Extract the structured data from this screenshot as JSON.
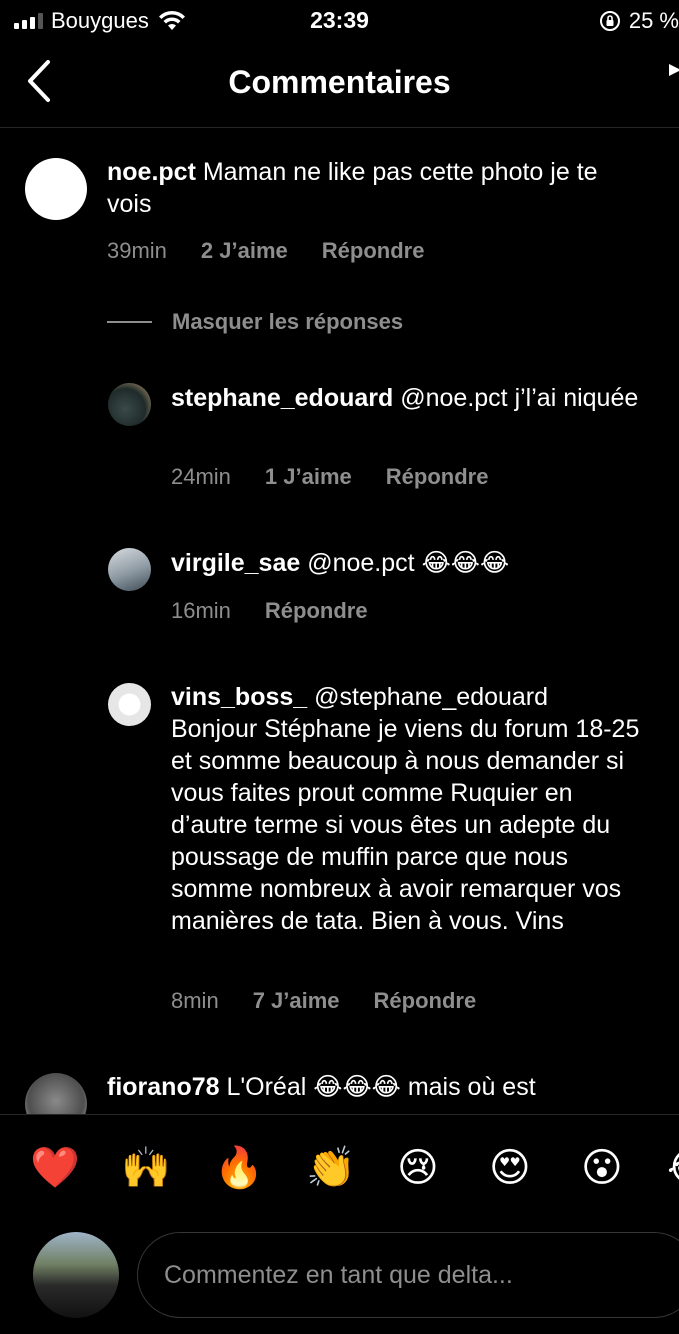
{
  "status_bar": {
    "carrier": "Bouygues",
    "time": "23:39",
    "battery": "25 %"
  },
  "header": {
    "title": "Commentaires"
  },
  "comments": [
    {
      "username": "noe.pct",
      "text": "Maman ne like pas cette photo je te vois",
      "time": "39min",
      "likes": "2 J’aime",
      "reply": "Répondre"
    },
    {
      "username": "stephane_edouard",
      "mention": "@noe.pct",
      "text": "j’l’ai niquée",
      "time": "24min",
      "likes": "1 J’aime",
      "reply": "Répondre"
    },
    {
      "username": "virgile_sae",
      "mention": "@noe.pct",
      "text": "😂😂😂",
      "time": "16min",
      "reply": "Répondre"
    },
    {
      "username": "vins_boss_",
      "mention": "@stephane_edouard",
      "text": "Bonjour Stéphane je viens du forum 18-25 et somme beaucoup à nous demander si vous faites prout comme Ruquier en d’autre terme si vous êtes un adepte du poussage de muffin parce que nous somme nombreux à avoir remarquer vos manières de tata. Bien à vous. Vins",
      "time": "8min",
      "likes": "7 J’aime",
      "reply": "Répondre"
    },
    {
      "username": "fiorano78",
      "text": "L'Oréal 😂😂😂 mais où est"
    }
  ],
  "hide_replies": "Masquer les réponses",
  "emoji_bar": [
    "❤️",
    "🙌",
    "🔥",
    "👏",
    "😢",
    "😍",
    "😮",
    "😂"
  ],
  "composer": {
    "placeholder": "Commentez en tant que delta..."
  },
  "colors": {
    "background": "#000000",
    "muted_text": "#8e8e8e",
    "divider": "#262626"
  }
}
